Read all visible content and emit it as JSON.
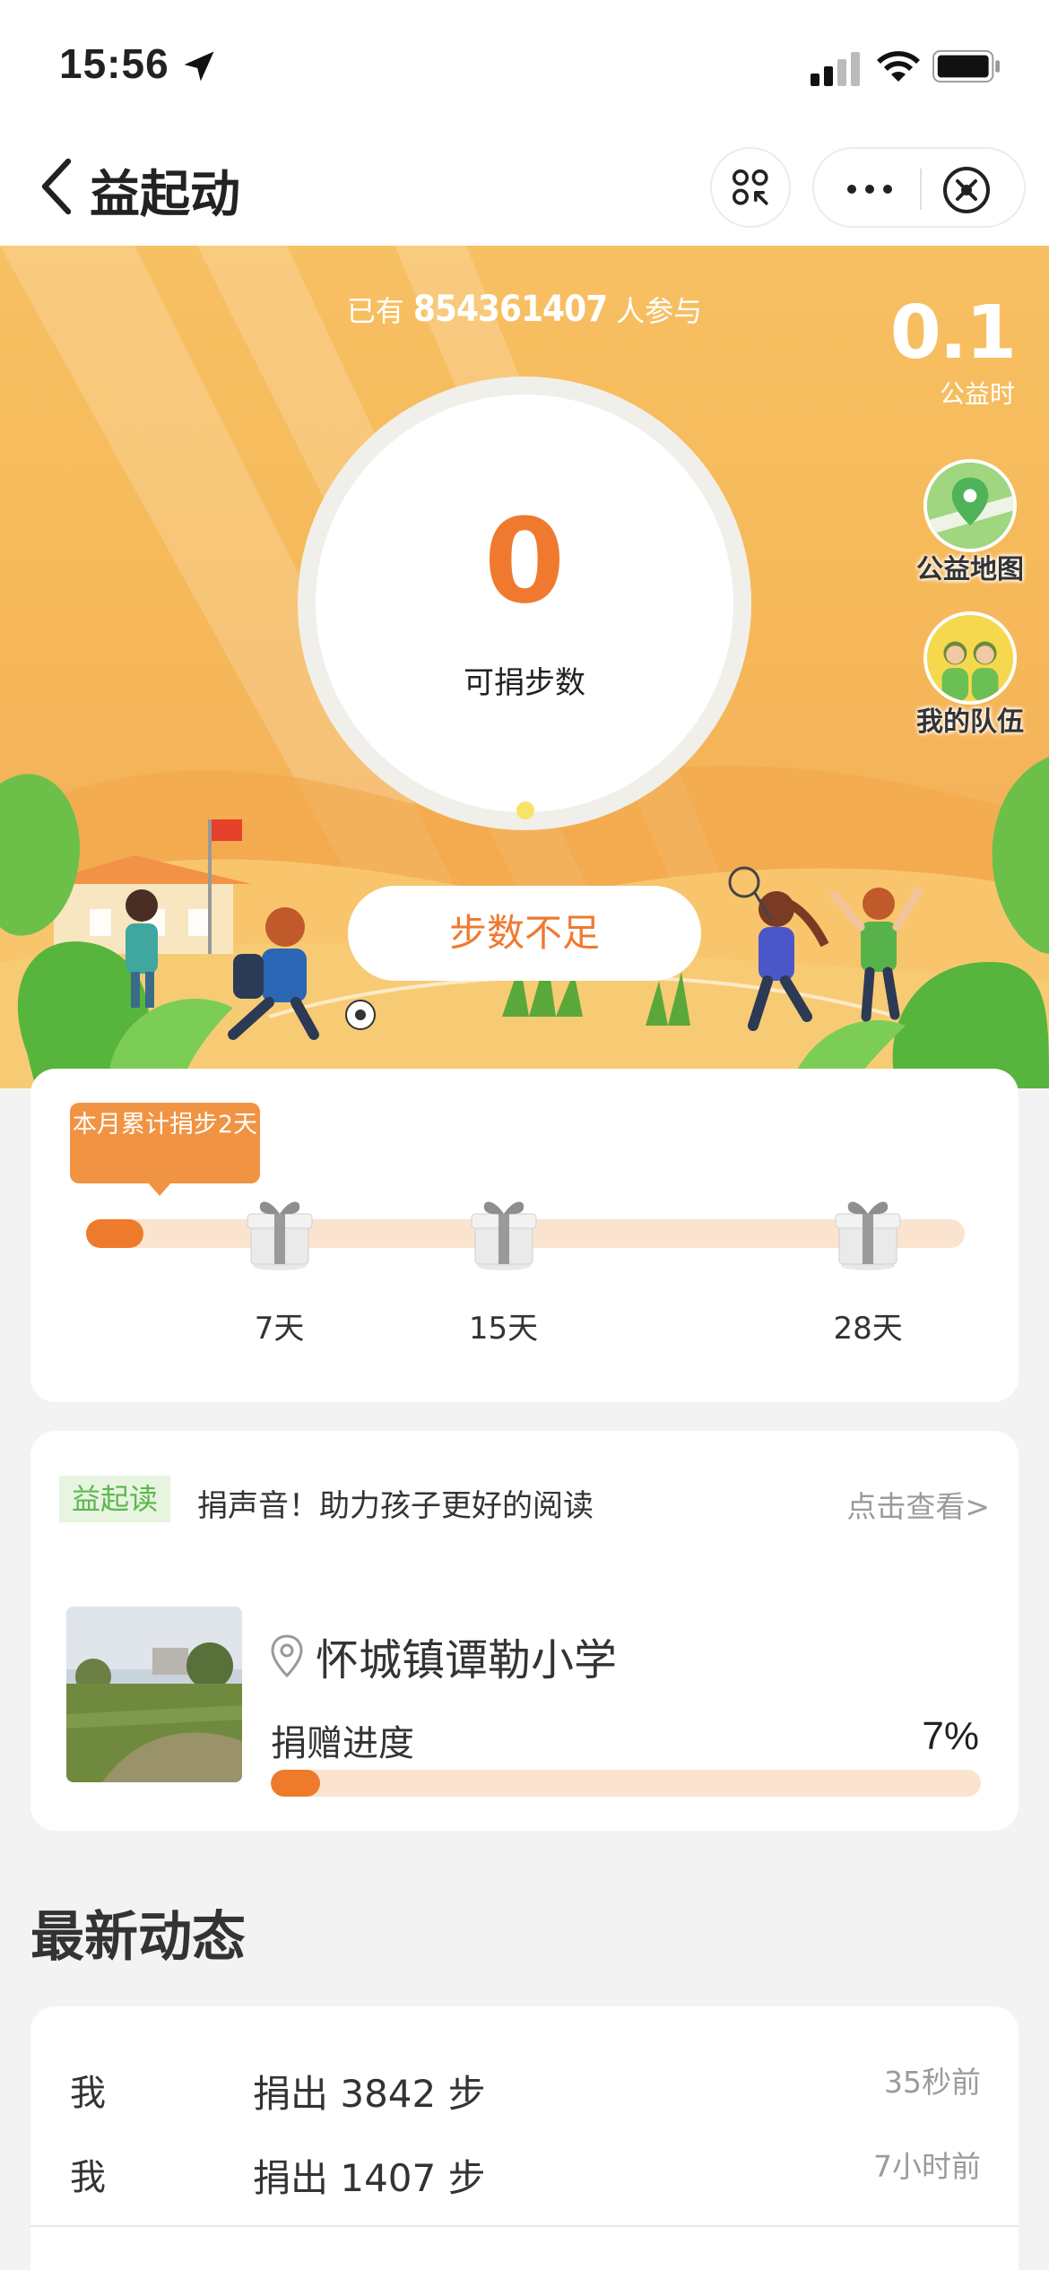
{
  "status_bar": {
    "time": "15:56"
  },
  "nav": {
    "title": "益起动"
  },
  "hero": {
    "participants_prefix": "已有",
    "participants_count": "854361407",
    "participants_suffix": "人参与",
    "welfare_hours_value": "0.1",
    "welfare_hours_label": "公益时",
    "donatable_steps": "0",
    "donatable_steps_label": "可捐步数",
    "map_label": "公益地图",
    "team_label": "我的队伍",
    "action_button": "步数不足"
  },
  "monthly": {
    "tooltip": "本月累计捐步2天",
    "progress_fraction": 0.065,
    "milestones": [
      {
        "label": "7天",
        "fraction": 0.22
      },
      {
        "label": "15天",
        "fraction": 0.475
      },
      {
        "label": "28天",
        "fraction": 0.89
      }
    ]
  },
  "project": {
    "tag": "益起读",
    "headline": "捐声音！助力孩子更好的阅读",
    "link": "点击查看>",
    "school": "怀城镇谭勒小学",
    "progress_label": "捐赠进度",
    "progress_percent_text": "7%",
    "progress_fraction": 0.07
  },
  "news": {
    "title": "最新动态",
    "items": [
      {
        "who": "我",
        "action": "捐出 3842 步",
        "time": "35秒前"
      },
      {
        "who": "我",
        "action": "捐出 1407 步",
        "time": "7小时前"
      }
    ]
  },
  "colors": {
    "accent": "#ee7a2c",
    "hero": "#f6b95a",
    "tag_green": "#5bb84c"
  }
}
